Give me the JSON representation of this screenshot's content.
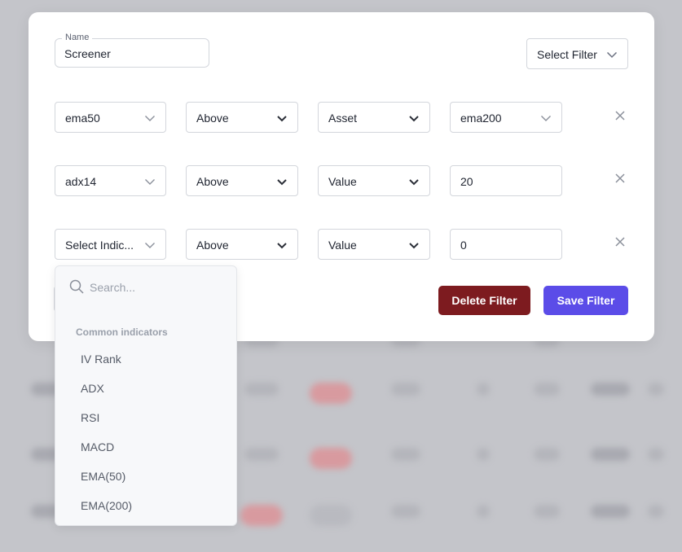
{
  "modal": {
    "name_label": "Name",
    "name_value": "Screener",
    "select_filter_label": "Select Filter"
  },
  "rows": [
    {
      "indicator": "ema50",
      "condition": "Above",
      "compare_type": "Asset",
      "target": "ema200",
      "target_is_select": true
    },
    {
      "indicator": "adx14",
      "condition": "Above",
      "compare_type": "Value",
      "target": "20",
      "target_is_select": false
    },
    {
      "indicator": "Select Indic...",
      "condition": "Above",
      "compare_type": "Value",
      "target": "0",
      "target_is_select": false
    }
  ],
  "buttons": {
    "delete_label": "Delete Filter",
    "save_label": "Save Filter"
  },
  "dropdown": {
    "search_placeholder": "Search...",
    "heading": "Common indicators",
    "items": [
      "IV Rank",
      "ADX",
      "RSI",
      "MACD",
      "EMA(50)",
      "EMA(200)"
    ]
  },
  "colors": {
    "save_button": "#5b4ce8",
    "delete_button": "#7d1b1f",
    "overlay": "#c4c5ca"
  },
  "icons": {
    "chevron": "chevron-down-icon",
    "remove": "close-icon",
    "search": "search-icon"
  }
}
